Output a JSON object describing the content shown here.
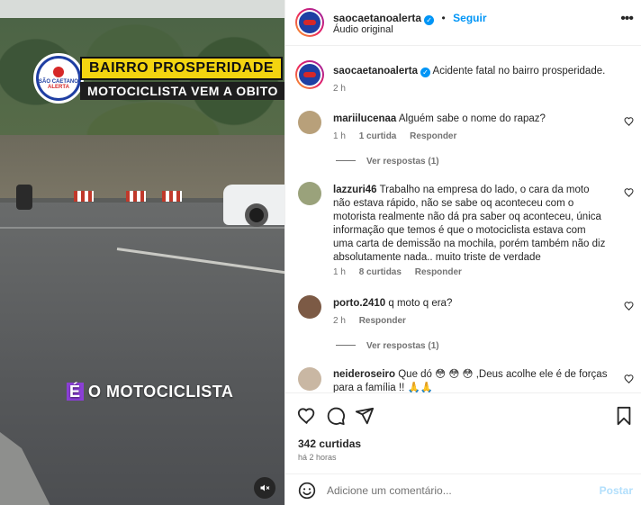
{
  "video": {
    "badge_logo_text": [
      "SÃO CAETANO",
      "ALERTA"
    ],
    "headline_top": "BAIRRO PROSPERIDADE",
    "headline_bottom": "MOTOCICLISTA VEM A OBITO",
    "caption_highlight": "É",
    "caption_rest": "O MOTOCICLISTA",
    "mute_icon": "speaker-muted-icon"
  },
  "header": {
    "username": "saocaetanoalerta",
    "follow_label": "Seguir",
    "audio": "Áudio original",
    "more_icon": "more-horizontal-icon"
  },
  "caption_post": {
    "username": "saocaetanoalerta",
    "text": "Acidente fatal no bairro prosperidade.",
    "time": "2 h"
  },
  "comments": [
    {
      "username": "mariilucenaa",
      "text": "Alguém sabe o nome do rapaz?",
      "time": "1 h",
      "likes": "1 curtida",
      "reply": "Responder",
      "view_replies": "Ver respostas (1)",
      "avatar_color": "#b8a07a"
    },
    {
      "username": "lazzuri46",
      "text": "Trabalho na empresa do lado, o cara da moto não estava rápido, não se sabe oq aconteceu com o motorista realmente não dá pra saber oq aconteceu, única informação que temos é que o motociclista estava com uma carta de demissão na mochila, porém também não diz absolutamente nada.. muito triste de verdade",
      "time": "1 h",
      "likes": "8 curtidas",
      "reply": "Responder",
      "avatar_color": "#9aa27b"
    },
    {
      "username": "porto.2410",
      "text": "q moto q era?",
      "time": "2 h",
      "reply": "Responder",
      "view_replies": "Ver respostas (1)",
      "avatar_color": "#7c5a45"
    },
    {
      "username": "neideroseiro",
      "text": "Que dó 😳 😳 😳 ,Deus acolhe ele é de forças para a família !! 🙏🙏",
      "avatar_color": "#c9b7a3"
    }
  ],
  "actions": {
    "like_icon": "heart-icon",
    "comment_icon": "comment-icon",
    "share_icon": "send-icon",
    "save_icon": "bookmark-icon",
    "likes_count": "342 curtidas",
    "posted_ago": "há 2 horas"
  },
  "add_comment": {
    "emoji_icon": "emoji-icon",
    "placeholder": "Adicione um comentário...",
    "post_label": "Postar"
  },
  "colors": {
    "accent": "#0095f6",
    "muted_text": "#737373",
    "headline_yellow": "#f3d410",
    "brand_blue": "#1f3fa3",
    "brand_red": "#d62828"
  }
}
